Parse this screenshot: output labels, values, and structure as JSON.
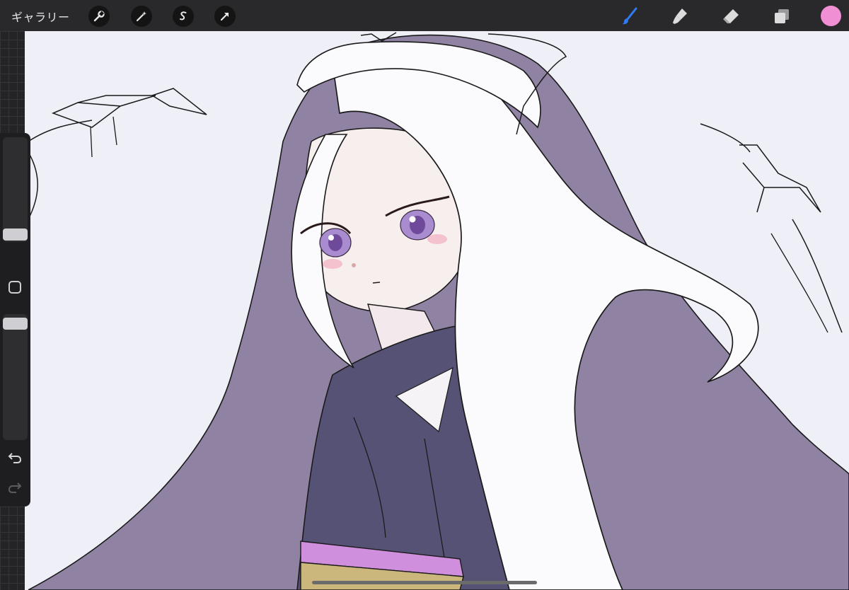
{
  "toolbar": {
    "gallery_label": "ギャラリー",
    "left_tools": [
      "wrench-icon",
      "magic-wand-icon",
      "selection-icon",
      "transform-arrow-icon"
    ],
    "right_tools": [
      "brush-icon",
      "smudge-icon",
      "eraser-icon",
      "layers-icon"
    ],
    "active_tool": "brush-icon",
    "active_tool_color": "#2f7bf5",
    "current_color": "#f18fd4"
  },
  "sidebar": {
    "brush_size_slider_value": 0.2,
    "opacity_slider_value": 0.9,
    "buttons": [
      "square-modify-button",
      "undo-button",
      "redo-button"
    ]
  },
  "canvas": {
    "background_color": "#efeff7",
    "artwork": "illustration"
  }
}
